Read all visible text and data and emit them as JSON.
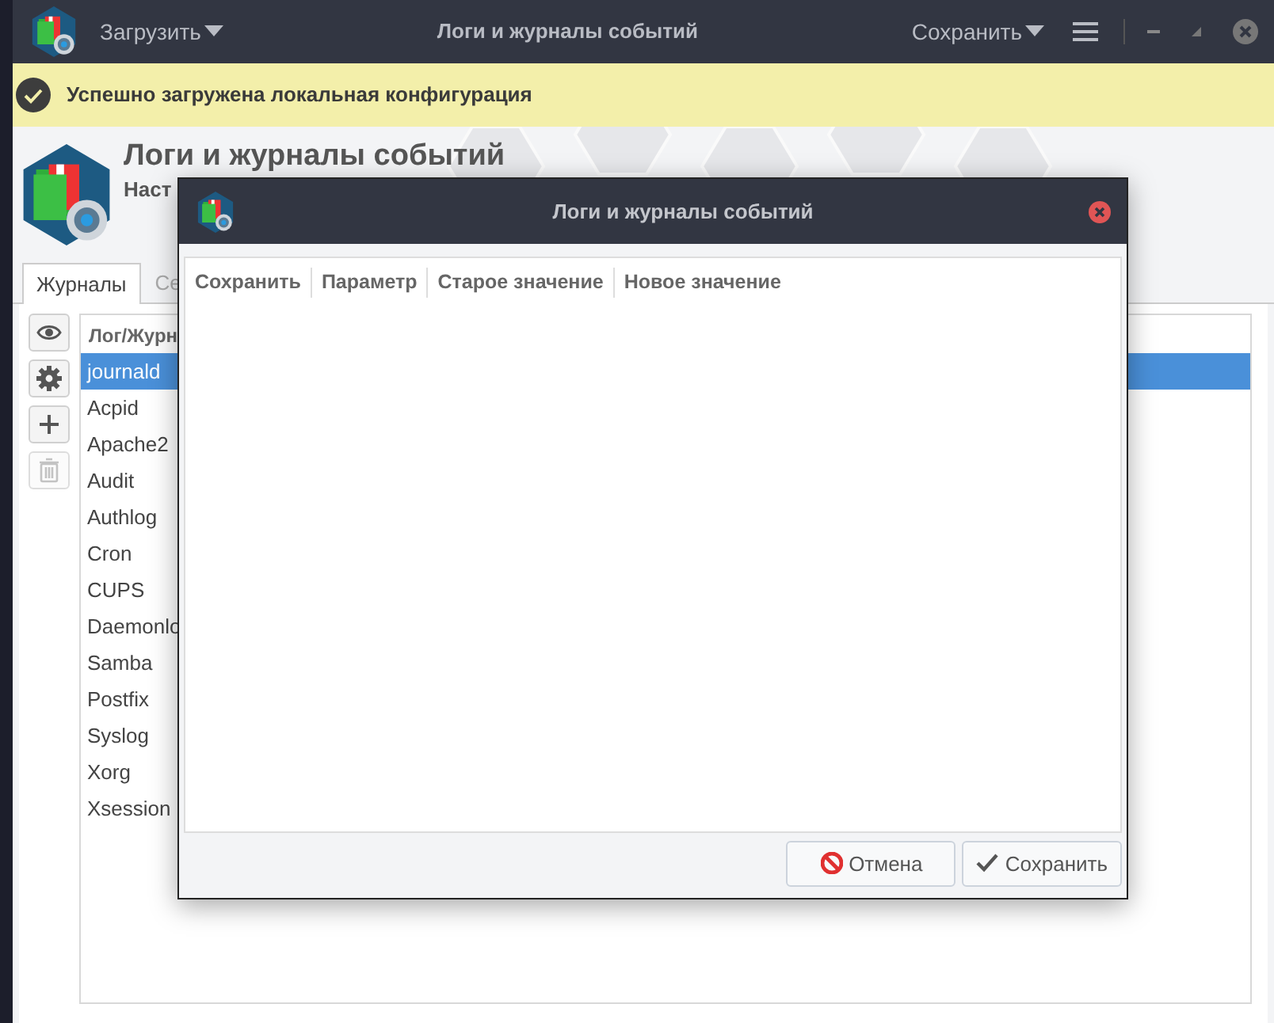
{
  "window": {
    "load_menu": "Загрузить",
    "title": "Логи и журналы событий",
    "save_menu": "Сохранить"
  },
  "notification": {
    "text": "Успешно загружена локальная конфигурация"
  },
  "header": {
    "title": "Логи и журналы событий",
    "subtitle": "Наст"
  },
  "tabs": [
    {
      "label": "Журналы",
      "selected": true
    },
    {
      "label": "Се",
      "selected": false
    }
  ],
  "toolbar": [
    {
      "kind": "view",
      "disabled": false
    },
    {
      "kind": "settings",
      "disabled": false
    },
    {
      "kind": "add",
      "disabled": false
    },
    {
      "kind": "delete",
      "disabled": true
    }
  ],
  "list": {
    "column": "Лог/Журн",
    "rows": [
      {
        "label": "journald",
        "selected": true
      },
      {
        "label": "Acpid",
        "selected": false
      },
      {
        "label": "Apache2",
        "selected": false
      },
      {
        "label": "Audit",
        "selected": false
      },
      {
        "label": "Authlog",
        "selected": false
      },
      {
        "label": "Cron",
        "selected": false
      },
      {
        "label": "CUPS",
        "selected": false
      },
      {
        "label": "Daemonlo",
        "selected": false
      },
      {
        "label": "Samba",
        "selected": false
      },
      {
        "label": "Postfix",
        "selected": false
      },
      {
        "label": "Syslog",
        "selected": false
      },
      {
        "label": "Xorg",
        "selected": false
      },
      {
        "label": "Xsession",
        "selected": false
      }
    ]
  },
  "dialog": {
    "title": "Логи и журналы событий",
    "columns": [
      "Сохранить",
      "Параметр",
      "Старое значение",
      "Новое значение"
    ],
    "buttons": [
      {
        "kind": "cancel",
        "label": "Отмена"
      },
      {
        "kind": "save",
        "label": "Сохранить"
      }
    ]
  }
}
